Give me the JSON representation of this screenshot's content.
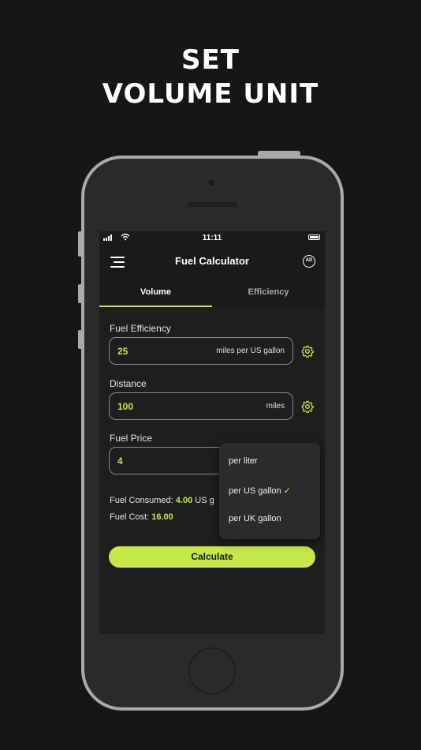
{
  "headline": {
    "line1": "SET",
    "line2": "VOLUME UNIT"
  },
  "status_bar": {
    "time": "11:11"
  },
  "app_bar": {
    "title": "Fuel Calculator",
    "ad_badge": "AD"
  },
  "tabs": [
    {
      "label": "Volume",
      "active": true
    },
    {
      "label": "Efficiency",
      "active": false
    }
  ],
  "form": {
    "fuel_efficiency": {
      "label": "Fuel Efficiency",
      "value": "25",
      "unit": "miles per US gallon"
    },
    "distance": {
      "label": "Distance",
      "value": "100",
      "unit": "miles"
    },
    "fuel_price": {
      "label": "Fuel Price",
      "value": "4"
    }
  },
  "results": {
    "consumed_label": "Fuel Consumed:",
    "consumed_value": "4.00",
    "consumed_unit": "US g",
    "cost_label": "Fuel Cost:",
    "cost_value": "16.00"
  },
  "calculate_label": "Calculate",
  "unit_dropdown": {
    "options": [
      "per liter",
      "per US gallon",
      "per UK gallon"
    ],
    "selected": "per US gallon",
    "check_mark": "✓"
  },
  "colors": {
    "accent": "#c6e84b",
    "background": "#161616",
    "screen": "#1e1e1f"
  }
}
